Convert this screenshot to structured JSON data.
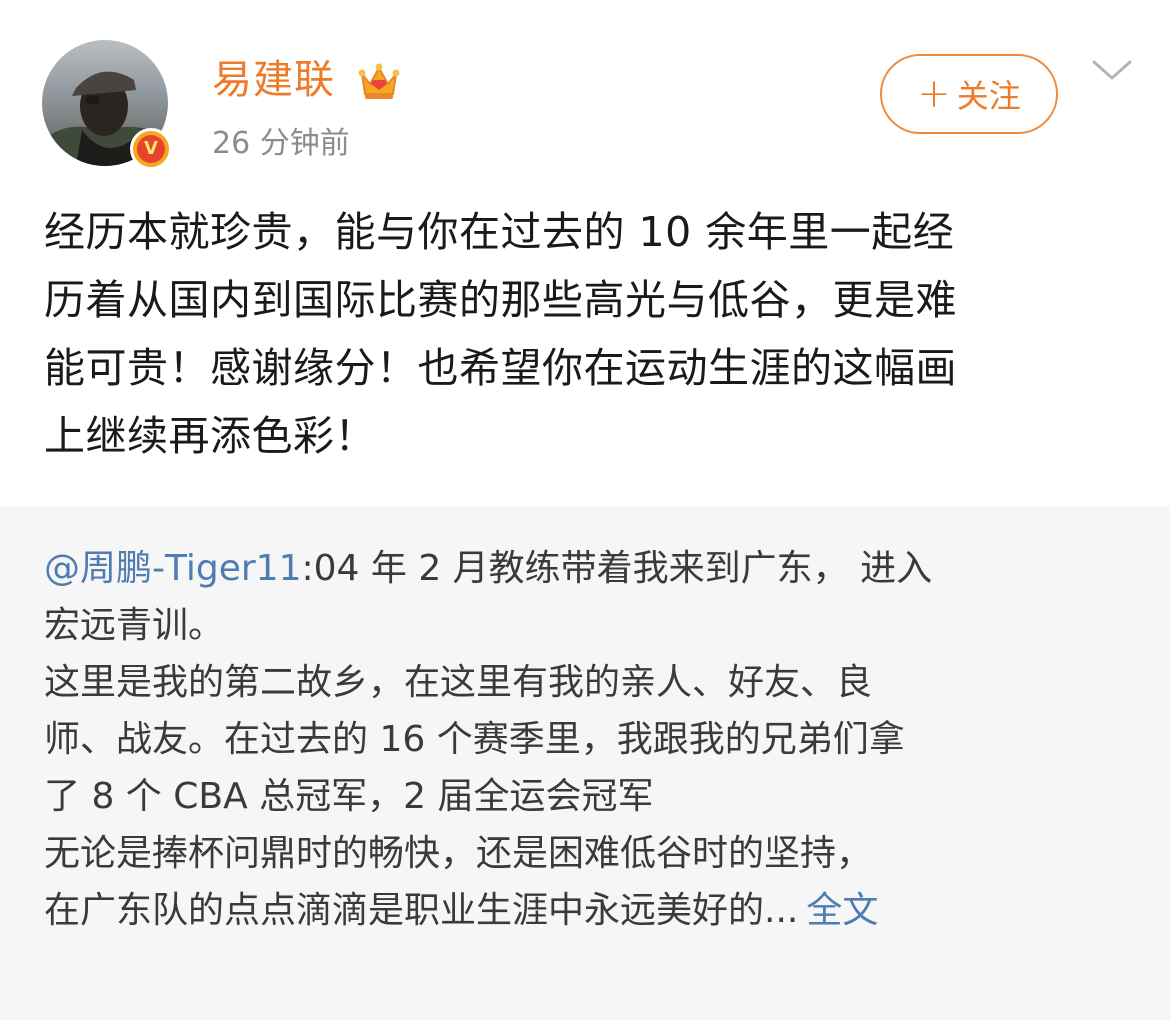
{
  "author": {
    "name": "易建联",
    "time": "26 分钟前",
    "verified_badge": "V"
  },
  "follow_button": {
    "plus": "+",
    "label": "关注"
  },
  "post": {
    "lines": [
      "经历本就珍贵，能与你在过去的 10 余年里一起经",
      "历着从国内到国际比赛的那些高光与低谷，更是难",
      "能可贵！感谢缘分！也希望你在运动生涯的这幅画",
      "上继续再添色彩！"
    ]
  },
  "repost": {
    "mention": "@周鹏-Tiger11",
    "first_line_rest": ":04 年 2 月教练带着我来到广东， 进入",
    "lines": [
      "宏远青训。",
      "这里是我的第二故乡，在这里有我的亲人、好友、良",
      "师、战友。在过去的 16 个赛季里，我跟我的兄弟们拿",
      "了 8 个 CBA 总冠军，2 届全运会冠军",
      "无论是捧杯问鼎时的畅快，还是困难低谷时的坚持，"
    ],
    "last_line": "在广东队的点点滴滴是职业生涯中永远美好的...",
    "full_text_link": "全文"
  },
  "colors": {
    "accent_orange": "#ee7b29",
    "link_blue": "#4f7cb3",
    "repost_bg": "#f6f6f6",
    "muted_text": "#8c8c8c"
  },
  "icons": [
    "avatar",
    "verified-badge-icon",
    "crown-icon",
    "chevron-down-icon"
  ]
}
